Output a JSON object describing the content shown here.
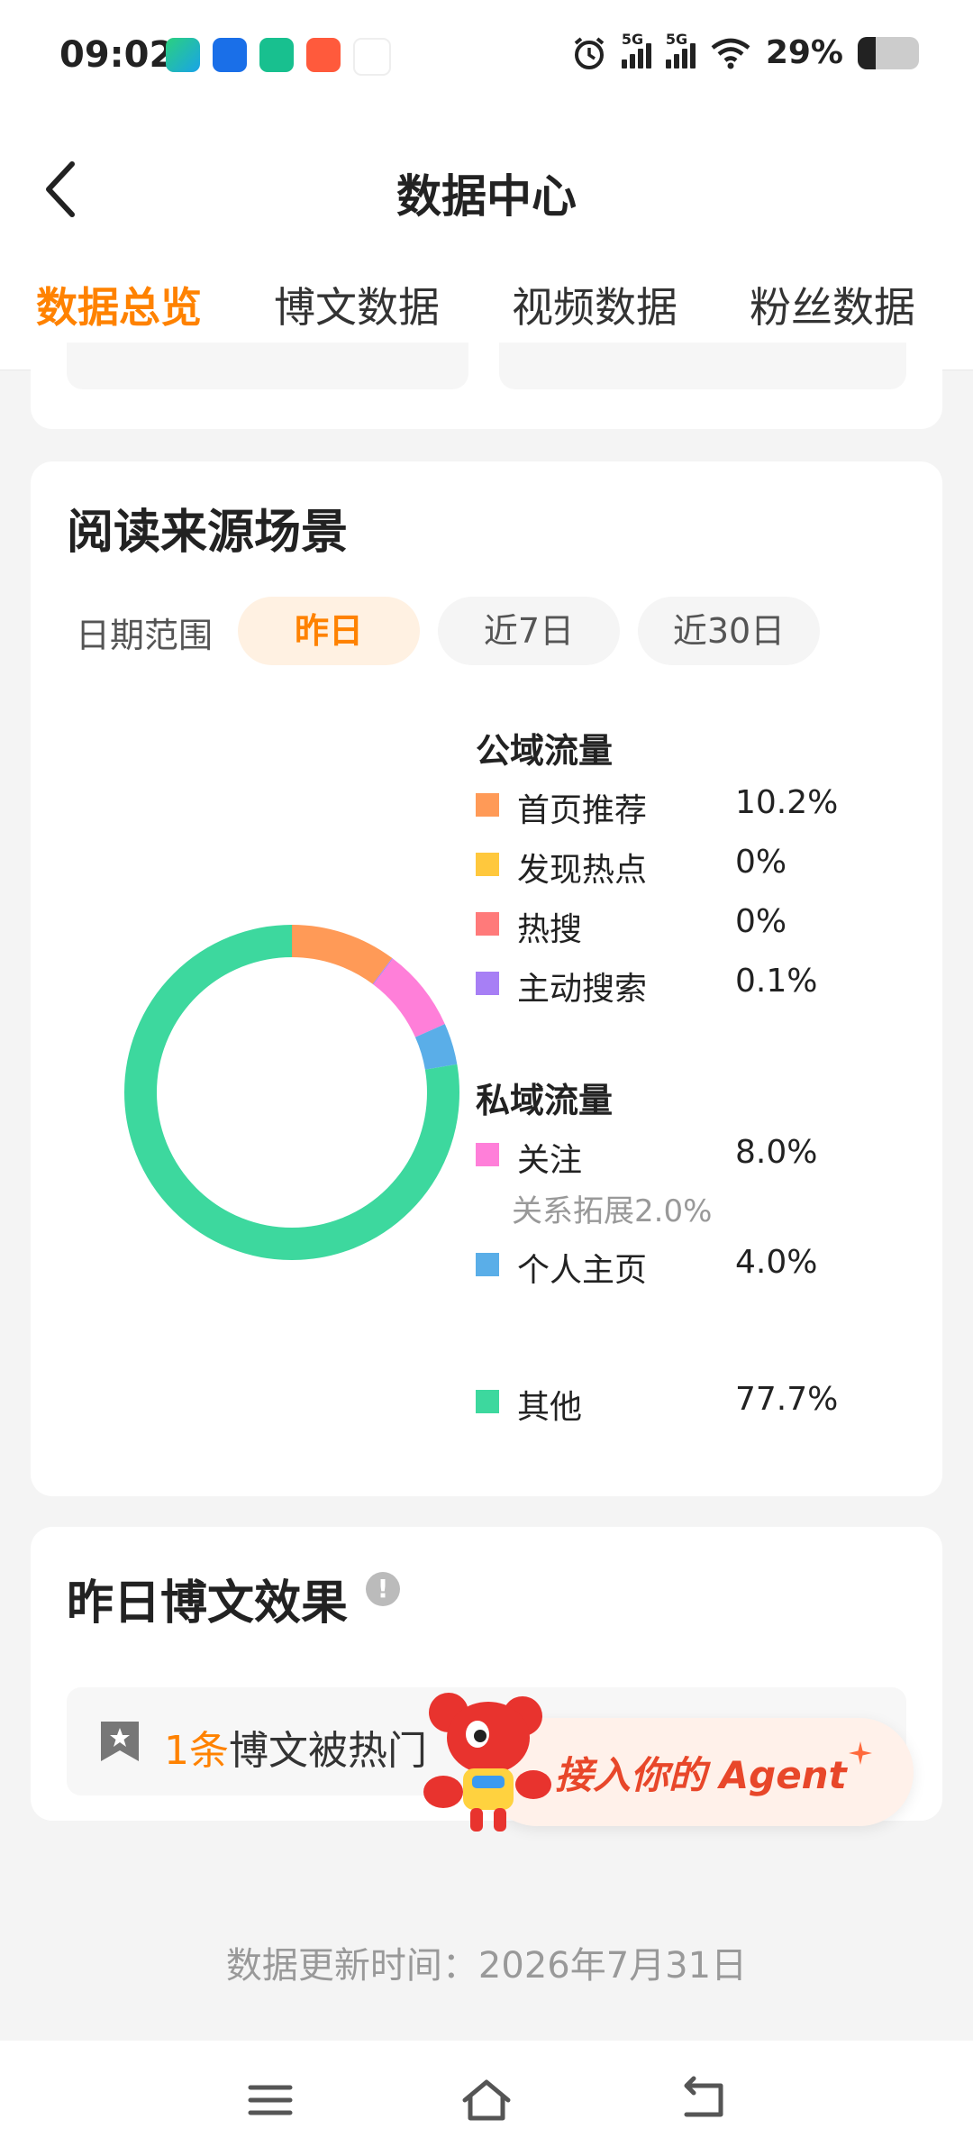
{
  "status_bar": {
    "time": "09:02",
    "signal1_label": "5G",
    "signal2_label": "5G",
    "battery": "29%",
    "battery_level": 0.29
  },
  "header": {
    "title": "数据中心"
  },
  "tabs": [
    {
      "label": "数据总览",
      "active": true
    },
    {
      "label": "博文数据",
      "active": false
    },
    {
      "label": "视频数据",
      "active": false
    },
    {
      "label": "粉丝数据",
      "active": false
    }
  ],
  "reading_source": {
    "title": "阅读来源场景",
    "range_label": "日期范围",
    "ranges": [
      {
        "label": "昨日",
        "active": true
      },
      {
        "label": "近7日",
        "active": false
      },
      {
        "label": "近30日",
        "active": false
      }
    ],
    "public_title": "公域流量",
    "public_items": [
      {
        "name": "首页推荐",
        "percent": "10.2%",
        "color": "#ff9a57"
      },
      {
        "name": "发现热点",
        "percent": "0%",
        "color": "#ffc83d"
      },
      {
        "name": "热搜",
        "percent": "0%",
        "color": "#ff7a7a"
      },
      {
        "name": "主动搜索",
        "percent": "0.1%",
        "color": "#a77ff5"
      }
    ],
    "private_title": "私域流量",
    "private_items": [
      {
        "name": "关注",
        "percent": "8.0%",
        "color": "#ff7fd9"
      },
      {
        "name": "个人主页",
        "percent": "4.0%",
        "color": "#5aaee8"
      }
    ],
    "follow_note": "关系拓展2.0%",
    "other_item": {
      "name": "其他",
      "percent": "77.7%",
      "color": "#3dd89e"
    }
  },
  "chart_data": {
    "type": "pie",
    "categories": [
      "首页推荐",
      "发现热点",
      "热搜",
      "主动搜索",
      "关注",
      "个人主页",
      "其他"
    ],
    "values": [
      10.2,
      0,
      0,
      0.1,
      8.0,
      4.0,
      77.7
    ],
    "colors": [
      "#ff9a57",
      "#ffc83d",
      "#ff7a7a",
      "#a77ff5",
      "#ff7fd9",
      "#5aaee8",
      "#3dd89e"
    ],
    "title": "阅读来源场景"
  },
  "yesterday_effect": {
    "title": "昨日博文效果",
    "info_icon": "!",
    "count": "1条",
    "text": "博文被热门"
  },
  "agent_banner": {
    "text": "接入你的 Agent"
  },
  "footer": {
    "update_time": "数据更新时间：2026年7月31日"
  },
  "icons": {
    "back": "chevron-left-icon",
    "menu": "menu-icon",
    "home": "home-icon",
    "return": "return-icon"
  }
}
